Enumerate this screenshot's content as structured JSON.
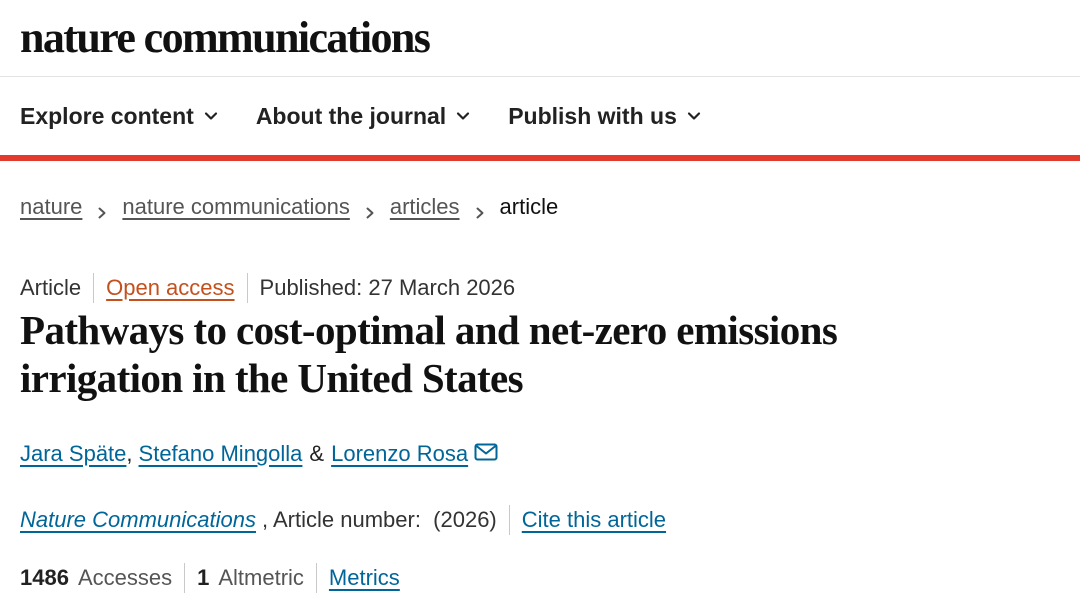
{
  "brand": {
    "name": "nature communications"
  },
  "nav": {
    "items": [
      {
        "label": "Explore content"
      },
      {
        "label": "About the journal"
      },
      {
        "label": "Publish with us"
      }
    ]
  },
  "breadcrumb": {
    "items": [
      "nature",
      "nature communications",
      "articles"
    ],
    "current": "article"
  },
  "meta": {
    "type": "Article",
    "access": "Open access",
    "published": "Published: 27 March 2026"
  },
  "article": {
    "title_line1": "Pathways to cost-optimal and net-zero emissions",
    "title_line2": "irrigation in the United States"
  },
  "authors": {
    "items": [
      "Jara Späte",
      "Stefano Mingolla",
      "Lorenzo Rosa"
    ],
    "sep_comma": ",",
    "sep_amp": "&"
  },
  "journal": {
    "name": "Nature Communications",
    "number_text": ", Article number:  (2026)",
    "cite_label": "Cite this article"
  },
  "metrics": {
    "accesses_count": "1486",
    "accesses_label": "Accesses",
    "altmetric_count": "1",
    "altmetric_label": "Altmetric",
    "metrics_label": "Metrics"
  },
  "colors": {
    "accent": "#e23a2d",
    "link": "#006699",
    "open_access": "#c4501e"
  }
}
